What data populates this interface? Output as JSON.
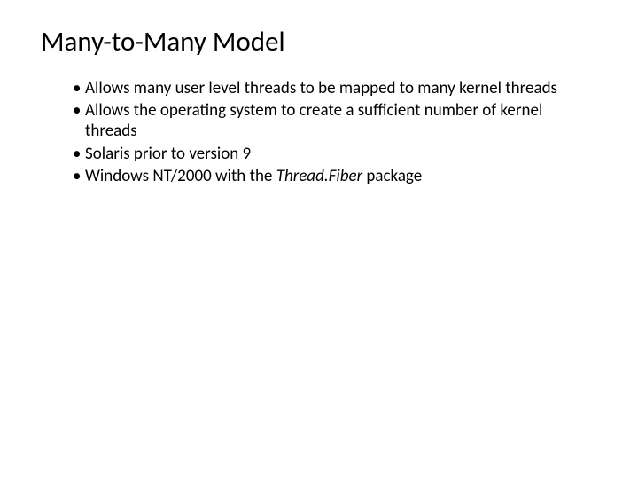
{
  "slide": {
    "title": "Many-to-Many Model",
    "bullets": [
      {
        "text": "Allows many user level threads to be mapped to many kernel threads"
      },
      {
        "text": "Allows the  operating system to create a sufficient number of kernel threads"
      },
      {
        "text": "Solaris prior to version 9"
      },
      {
        "prefix": "Windows NT/2000 with the ",
        "italic": "Thread.Fiber",
        "suffix": " package"
      }
    ]
  }
}
